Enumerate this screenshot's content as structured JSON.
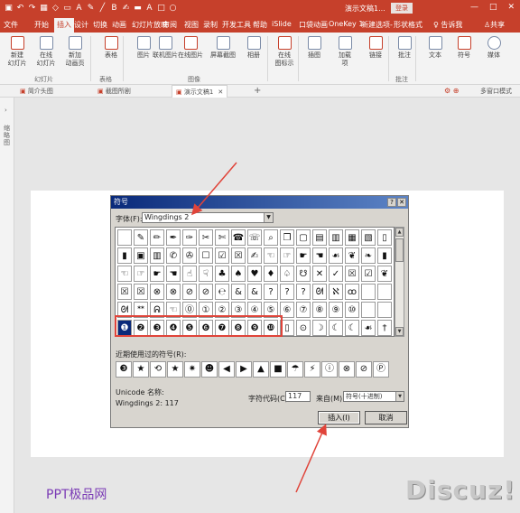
{
  "qat_icons": [
    "save-icon",
    "undo-icon",
    "redo-icon",
    "start-from-beginning-icon",
    "shape-icon",
    "text-box-icon",
    "font-color-icon",
    "eyedropper-icon",
    "line-icon",
    "bold-icon",
    "brush-icon",
    "highlight-icon",
    "font-a-icon",
    "rectangle-icon",
    "circle-icon"
  ],
  "qat_glyphs": [
    "▣",
    "↶",
    "↷",
    "▦",
    "◇",
    "▭",
    "A",
    "✎",
    "╱",
    "B",
    "✍",
    "▬",
    "A",
    "□",
    "○"
  ],
  "window": {
    "doc_title": "演示文稿1...",
    "login_label": "登录",
    "min": "—",
    "max": "□",
    "close": "✕"
  },
  "ribbon_tabs": [
    "文件",
    "开始",
    "插入",
    "设计",
    "切换",
    "动画",
    "幻灯片放映",
    "审阅",
    "视图",
    "录制",
    "开发工具",
    "帮助",
    "iSlide",
    "口袋动画",
    "OneKey 1",
    "新建选项-",
    "形状格式"
  ],
  "active_tab_index": 2,
  "tell_me": "告诉我",
  "share": "共享",
  "ribbon": {
    "buttons": [
      {
        "label": "新建\n幻灯片",
        "name": "new-slide-button"
      },
      {
        "label": "在线\n幻灯片",
        "name": "online-slide-button"
      },
      {
        "label": "新加\n动画页",
        "name": "new-animation-page-button"
      },
      {
        "label": "表格",
        "name": "table-button"
      },
      {
        "label": "图片",
        "name": "picture-button"
      },
      {
        "label": "联机图片",
        "name": "online-picture-button"
      },
      {
        "label": "在线图片",
        "name": "online-image-button"
      },
      {
        "label": "屏幕截图",
        "name": "screenshot-button"
      },
      {
        "label": "相册",
        "name": "album-button"
      },
      {
        "label": "在线\n图标示",
        "name": "online-icons-button"
      },
      {
        "label": "插图",
        "name": "illustrations-button"
      },
      {
        "label": "加载\n项",
        "name": "add-ins-button"
      },
      {
        "label": "链接",
        "name": "link-button"
      },
      {
        "label": "批注",
        "name": "comment-button"
      },
      {
        "label": "文本",
        "name": "text-button"
      },
      {
        "label": "符号",
        "name": "symbol-button"
      },
      {
        "label": "媒体",
        "name": "media-button"
      }
    ],
    "groups": [
      "幻灯片",
      "表格",
      "图像",
      "批注"
    ]
  },
  "doc_tabs": [
    {
      "label": "简介头图",
      "close": ""
    },
    {
      "label": "截图所剧",
      "close": ""
    },
    {
      "label": "演示文稿1",
      "close": "✕"
    }
  ],
  "doc_mode": "多窗口模式",
  "doc_icons": "⚙ ⊕",
  "left_pane": {
    "arrow": "›",
    "label": "缩略图"
  },
  "dialog": {
    "title": "符号",
    "help": "?",
    "close": "✕",
    "font_label": "字体(F):",
    "font_value": "Wingdings 2",
    "grid_rows": [
      [
        "",
        "✎",
        "✏",
        "✒",
        "✑",
        "✂",
        "✄",
        "☎",
        "☏",
        "⌕",
        "❐",
        "▢",
        "▤",
        "▥",
        "▦",
        "▧",
        "▯"
      ],
      [
        "▮",
        "▣",
        "▥",
        "✆",
        "✇",
        "☐",
        "☑",
        "☒",
        "✍",
        "☜",
        "☞",
        "☛",
        "☚",
        "☙",
        "❦",
        "❧",
        "▮"
      ],
      [
        "☜",
        "☞",
        "☛",
        "☚",
        "☝",
        "☟",
        "♣",
        "♠",
        "♥",
        "♦",
        "♤",
        "☋",
        "✕",
        "✓",
        "☒",
        "☑",
        "❦"
      ],
      [
        "☒",
        "☒",
        "⊗",
        "⊗",
        "⊘",
        "⊘",
        "℮",
        "&",
        "&",
        "?",
        "?",
        "?",
        "ᘛ",
        "ℵ",
        "ꝏ",
        "",
        ""
      ],
      [
        "ᘛ",
        "ᕯ",
        "ᕱ",
        "☜",
        "⓪",
        "①",
        "②",
        "③",
        "④",
        "⑤",
        "⑥",
        "⑦",
        "⑧",
        "⑨",
        "⑩",
        "",
        ""
      ],
      [
        "❶",
        "❷",
        "❸",
        "❹",
        "❺",
        "❻",
        "❼",
        "❽",
        "❾",
        "❿",
        "▯",
        "⊙",
        "☽",
        "☾",
        "☾",
        "☙",
        "†"
      ]
    ],
    "selected": {
      "row": 5,
      "col": 0
    },
    "recent_label": "近期使用过的符号(R):",
    "recent": [
      "❸",
      "★",
      "⟲",
      "★",
      "✷",
      "☻",
      "◀",
      "▶",
      "▲",
      "■",
      "☂",
      "⚡",
      "ⓘ",
      "⊗",
      "⊘",
      "Ⓟ"
    ],
    "unicode_name_label": "Unicode 名称:",
    "char_name": "Wingdings 2: 117",
    "code_label": "字符代码(C):",
    "code_value": "117",
    "from_label": "来自(M):",
    "from_value": "符号(十进制)",
    "insert_label": "插入(I)",
    "cancel_label": "取消",
    "help_char": "?"
  },
  "watermark": {
    "left": "PPT极品网",
    "right": "Discuz!"
  },
  "colors": {
    "accent": "#c6402b",
    "dialog_bg": "#d8d5cf",
    "selection": "#0a2a7a",
    "highlight_box": "#e0443a",
    "watermark_purple": "#7b3bb5"
  }
}
